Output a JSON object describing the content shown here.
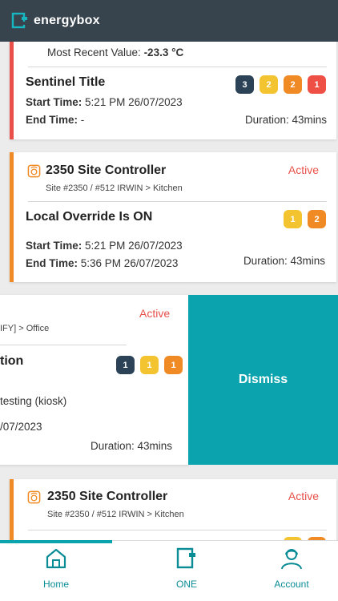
{
  "header": {
    "brand": "energybox"
  },
  "card1": {
    "recent_label": "Most Recent Value: ",
    "recent_value": "-23.3 °C",
    "title": "Sentinel Title",
    "start_label": "Start Time:",
    "start_value": "5:21 PM  26/07/2023",
    "end_label": "End Time:",
    "end_value": "-",
    "duration": "Duration: 43mins",
    "badges": [
      "3",
      "2",
      "2",
      "1"
    ]
  },
  "card2": {
    "site": "2350 Site Controller",
    "status": "Active",
    "path": "Site #2350 / #512 IRWIN > Kitchen",
    "title": "Local Override Is ON",
    "badges": [
      "1",
      "2"
    ],
    "start_label": "Start Time:",
    "start_value": "5:21 PM  26/07/2023",
    "end_label": "End Time:",
    "end_value": "5:36 PM  26/07/2023",
    "duration": "Duration: 43mins"
  },
  "card3": {
    "status": "Active",
    "path": "IFY] > Office",
    "title": "tion",
    "badges": [
      "1",
      "1",
      "1"
    ],
    "subject": "testing (kiosk)",
    "date": "/07/2023",
    "duration": "Duration: 43mins",
    "dismiss_label": "Dismiss"
  },
  "card4": {
    "site": "2350 Site Controller",
    "status": "Active",
    "path": "Site #2350 / #512 IRWIN > Kitchen"
  },
  "nav": {
    "home": "Home",
    "one": "ONE",
    "account": "Account"
  }
}
